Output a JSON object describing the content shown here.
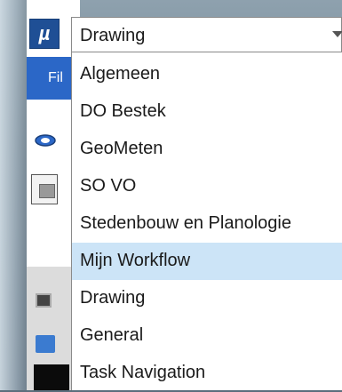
{
  "app": {
    "icon_glyph": "µ",
    "file_tab_label": "Fil"
  },
  "workflow_combo": {
    "selected_value": "Drawing"
  },
  "workflow_list": {
    "items": [
      {
        "label": "Algemeen",
        "selected": false
      },
      {
        "label": "DO Bestek",
        "selected": false
      },
      {
        "label": "GeoMeten",
        "selected": false
      },
      {
        "label": "SO VO",
        "selected": false
      },
      {
        "label": "Stedenbouw en Planologie",
        "selected": false
      },
      {
        "label": "Mijn Workflow",
        "selected": true
      },
      {
        "label": "Drawing",
        "selected": false
      },
      {
        "label": "General",
        "selected": false
      },
      {
        "label": "Task Navigation",
        "selected": false
      }
    ]
  },
  "colors": {
    "highlight": "#cce4f7",
    "ribbon": "#2b67c7",
    "app_icon": "#1f4f95"
  }
}
